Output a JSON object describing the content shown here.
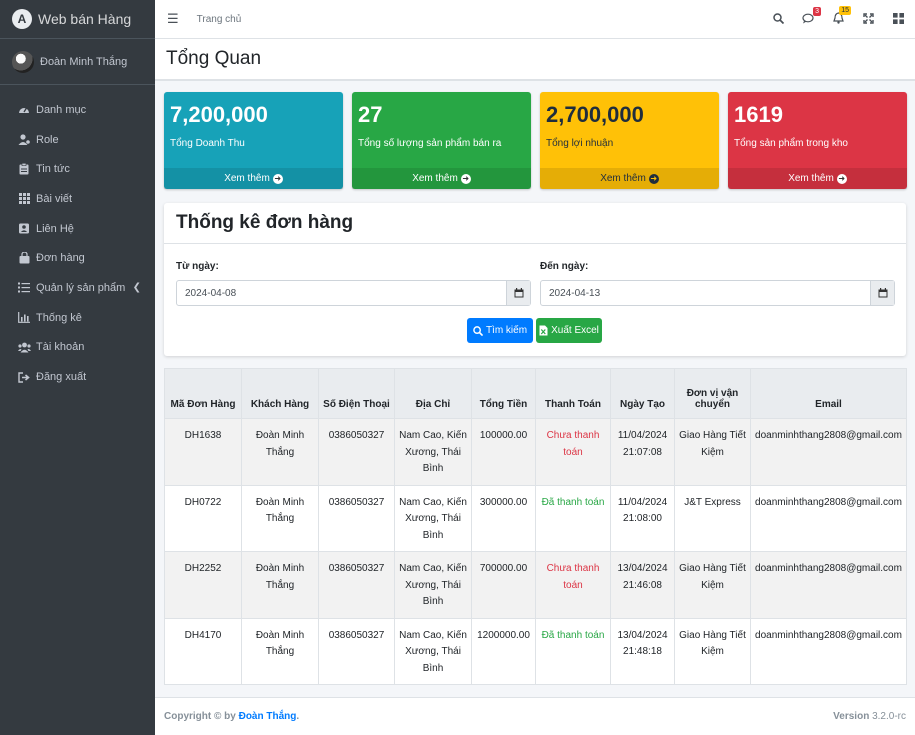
{
  "brand": {
    "name": "Web bán Hàng",
    "logo_letter": "A"
  },
  "user": {
    "name": "Đoàn Minh Thắng"
  },
  "sidebar": {
    "items": [
      {
        "label": "Danh mục",
        "icon": "tachometer-icon"
      },
      {
        "label": "Role",
        "icon": "user-icon"
      },
      {
        "label": "Tin tức",
        "icon": "clipboard-icon"
      },
      {
        "label": "Bài viết",
        "icon": "grid-icon"
      },
      {
        "label": "Liên Hệ",
        "icon": "contact-icon"
      },
      {
        "label": "Đơn hàng",
        "icon": "bag-icon"
      },
      {
        "label": "Quản lý sản phẩm",
        "icon": "list-icon"
      },
      {
        "label": "Thống kê",
        "icon": "chart-icon"
      },
      {
        "label": "Tài khoản",
        "icon": "users-icon"
      },
      {
        "label": "Đăng xuất",
        "icon": "logout-icon"
      }
    ]
  },
  "topbar": {
    "home": "Trang chủ",
    "messages_count": "3",
    "notifications_count": "15"
  },
  "page": {
    "title": "Tổng Quan"
  },
  "stats": [
    {
      "value": "7,200,000",
      "label": "Tổng Doanh Thu",
      "more": "Xem thêm"
    },
    {
      "value": "27",
      "label": "Tổng số lượng sản phẩm bán ra",
      "more": "Xem thêm"
    },
    {
      "value": "2,700,000",
      "label": "Tổng lợi nhuận",
      "more": "Xem thêm"
    },
    {
      "value": "1619",
      "label": "Tổng sản phẩm trong kho",
      "more": "Xem thêm"
    }
  ],
  "filter": {
    "title": "Thống kê đơn hàng",
    "from_label": "Từ ngày:",
    "from_value": "2024-04-08",
    "to_label": "Đến ngày:",
    "to_value": "2024-04-13",
    "search_label": "Tìm kiếm",
    "export_label": "Xuất Excel"
  },
  "table": {
    "headers": [
      "Mã Đơn Hàng",
      "Khách Hàng",
      "Số Điện Thoại",
      "Địa Chỉ",
      "Tổng Tiền",
      "Thanh Toán",
      "Ngày Tạo",
      "Đơn vị vận chuyển",
      "Email"
    ],
    "rows": [
      [
        "DH1638",
        "Đoàn Minh Thắng",
        "0386050327",
        "Nam Cao, Kiến Xương, Thái Bình",
        "100000.00",
        "Chưa thanh toán",
        "11/04/2024 21:07:08",
        "Giao Hàng Tiết Kiệm",
        "doanminhthang2808@gmail.com"
      ],
      [
        "DH0722",
        "Đoàn Minh Thắng",
        "0386050327",
        "Nam Cao, Kiến Xương, Thái Bình",
        "300000.00",
        "Đã thanh toán",
        "11/04/2024 21:08:00",
        "J&T Express",
        "doanminhthang2808@gmail.com"
      ],
      [
        "DH2252",
        "Đoàn Minh Thắng",
        "0386050327",
        "Nam Cao, Kiến Xương, Thái Bình",
        "700000.00",
        "Chưa thanh toán",
        "13/04/2024 21:46:08",
        "Giao Hàng Tiết Kiệm",
        "doanminhthang2808@gmail.com"
      ],
      [
        "DH4170",
        "Đoàn Minh Thắng",
        "0386050327",
        "Nam Cao, Kiến Xương, Thái Bình",
        "1200000.00",
        "Đã thanh toán",
        "13/04/2024 21:48:18",
        "Giao Hàng Tiết Kiệm",
        "doanminhthang2808@gmail.com"
      ]
    ]
  },
  "footer": {
    "copyright": "Copyright © by",
    "author": "Đoàn Thắng",
    "period": ".",
    "version_label": "Version",
    "version": "3.2.0-rc"
  },
  "colors": {
    "sidebar": "#343a40",
    "info": "#17a2b8",
    "success": "#28a745",
    "warning": "#ffc107",
    "danger": "#dc3545",
    "primary": "#007bff"
  }
}
